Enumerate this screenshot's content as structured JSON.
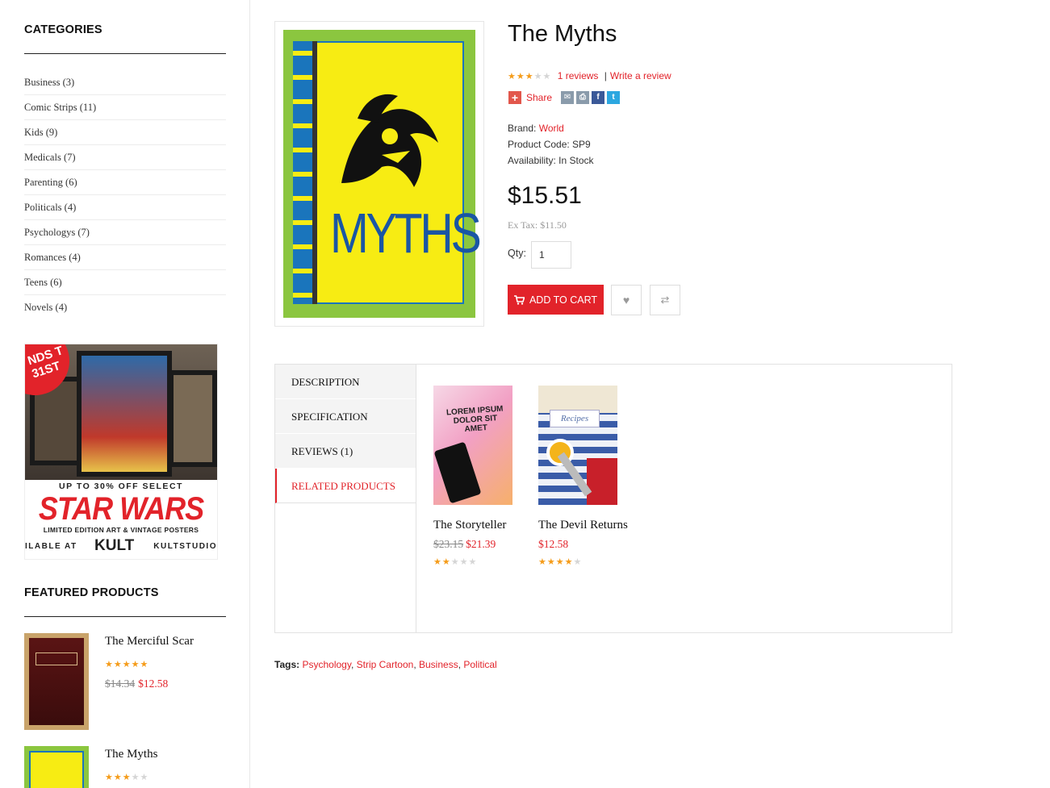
{
  "sidebar": {
    "categories_heading": "CATEGORIES",
    "categories": [
      {
        "label": "Business (3)"
      },
      {
        "label": "Comic Strips (11)"
      },
      {
        "label": "Kids (9)"
      },
      {
        "label": "Medicals (7)"
      },
      {
        "label": "Parenting (6)"
      },
      {
        "label": "Politicals (4)"
      },
      {
        "label": "Psychologys (7)"
      },
      {
        "label": "Romances (4)"
      },
      {
        "label": "Teens (6)"
      },
      {
        "label": "Novels (4)"
      }
    ],
    "banner": {
      "ribbon": "NDS T 31ST",
      "line1": "UP TO 30% OFF SELECT",
      "headline": "STAR WARS",
      "line2": "LIMITED EDITION ART & VINTAGE POSTERS",
      "footer_left": "ILABLE AT",
      "footer_brand": "KULT",
      "footer_right": "KULTSTUDIO"
    },
    "featured_heading": "FEATURED PRODUCTS",
    "featured": [
      {
        "name": "The Merciful Scar",
        "rating": 5,
        "old_price": "$14.34",
        "price": "$12.58"
      },
      {
        "name": "The Myths",
        "rating": 3
      }
    ]
  },
  "product": {
    "title": "The Myths",
    "rating": 3,
    "reviews_link": "1 reviews",
    "separator": "|",
    "write_review": "Write a review",
    "share_label": "Share",
    "brand_label": "Brand:",
    "brand_value": "World",
    "code_text": "Product Code: SP9",
    "availability_text": "Availability: In Stock",
    "price": "$15.51",
    "ex_tax": "Ex Tax: $11.50",
    "qty_label": "Qty:",
    "qty_value": "1",
    "add_to_cart": "ADD TO CART",
    "cover_title": "MYTHS"
  },
  "tabs": {
    "items": [
      {
        "label": "DESCRIPTION"
      },
      {
        "label": "SPECIFICATION"
      },
      {
        "label": "REVIEWS (1)"
      },
      {
        "label": "RELATED PRODUCTS"
      }
    ],
    "active_index": 3
  },
  "related": [
    {
      "name": "The Storyteller",
      "old_price": "$23.15",
      "price": "$21.39",
      "rating": 2,
      "cover_text": "LOREM IPSUM DOLOR SIT AMET"
    },
    {
      "name": "The Devil Returns",
      "price": "$12.58",
      "rating": 4,
      "cover_text": "Recipes"
    }
  ],
  "tags": {
    "label": "Tags:",
    "items": [
      "Psychology",
      "Strip Cartoon",
      "Business",
      "Political"
    ]
  },
  "colors": {
    "accent": "#e2232a",
    "star": "#f59c1a"
  }
}
